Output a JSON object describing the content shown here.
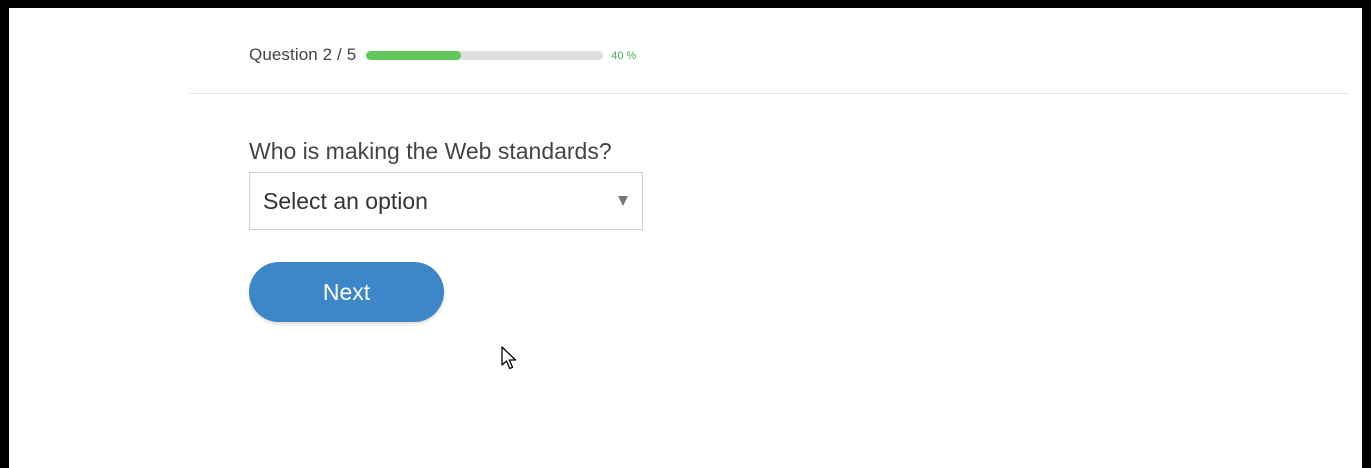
{
  "quiz": {
    "counter_text": "Question 2 / 5",
    "progress_percent": 40,
    "progress_label": "40 %",
    "question": "Who is making the Web standards?",
    "select_placeholder": "Select an option",
    "next_label": "Next"
  },
  "colors": {
    "progress_fill": "#5fc85a",
    "progress_track": "#dedede",
    "percent_text": "#4caf50",
    "button_bg": "#3d87c8",
    "frame_border": "#000000"
  },
  "icons": {
    "select_arrow": "chevron-down-icon",
    "pointer": "mouse-cursor-icon"
  }
}
